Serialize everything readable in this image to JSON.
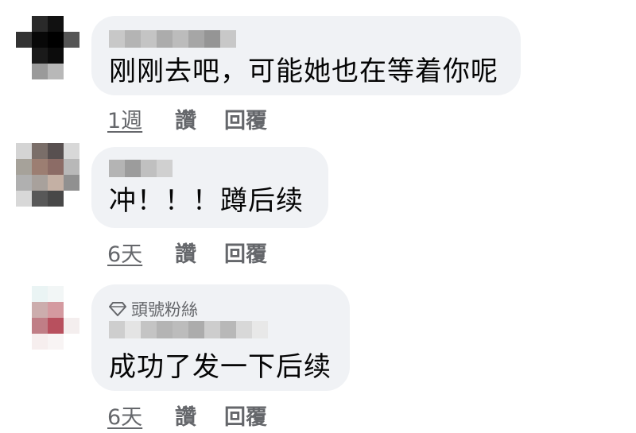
{
  "comments": [
    {
      "text": "刚刚去吧，可能她也在等着你呢",
      "time": "1週",
      "like": "讚",
      "reply": "回覆"
    },
    {
      "text": "冲！！！蹲后续",
      "time": "6天",
      "like": "讚",
      "reply": "回覆"
    },
    {
      "badge": "頭號粉絲",
      "text": "成功了发一下后续",
      "time": "6天",
      "like": "讚",
      "reply": "回覆"
    }
  ],
  "colors": {
    "bubble": "#f0f2f5",
    "text": "#050505",
    "meta": "#65676b"
  },
  "icons": {
    "badge": "diamond-icon"
  }
}
